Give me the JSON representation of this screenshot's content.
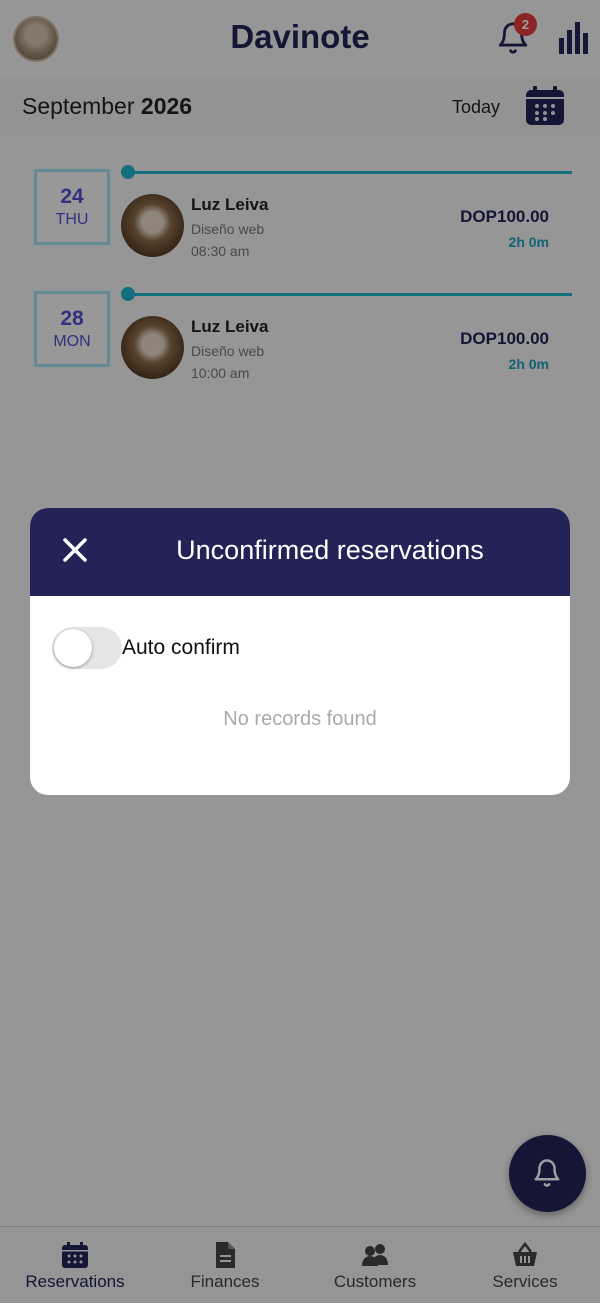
{
  "header": {
    "app_title": "Davinote",
    "notification_count": "2"
  },
  "monthbar": {
    "month": "September",
    "year": "2026",
    "today_label": "Today"
  },
  "reservations": [
    {
      "day": "24",
      "weekday": "THU",
      "customer": "Luz Leiva",
      "service": "Diseño web",
      "time": "08:30 am",
      "price": "DOP100.00",
      "duration": "2h 0m"
    },
    {
      "day": "28",
      "weekday": "MON",
      "customer": "Luz Leiva",
      "service": "Diseño web",
      "time": "10:00 am",
      "price": "DOP100.00",
      "duration": "2h 0m"
    }
  ],
  "modal": {
    "title": "Unconfirmed reservations",
    "toggle_label": "Auto confirm",
    "toggle_on": false,
    "empty_message": "No records found"
  },
  "bottom_nav": [
    {
      "label": "Reservations",
      "icon": "calendar-icon",
      "active": true
    },
    {
      "label": "Finances",
      "icon": "document-icon",
      "active": false
    },
    {
      "label": "Customers",
      "icon": "users-icon",
      "active": false
    },
    {
      "label": "Services",
      "icon": "basket-icon",
      "active": false
    }
  ],
  "colors": {
    "primary": "#232357",
    "accent": "#1fb3cc",
    "badge": "#e23b3b",
    "date_text": "#5151d0"
  }
}
